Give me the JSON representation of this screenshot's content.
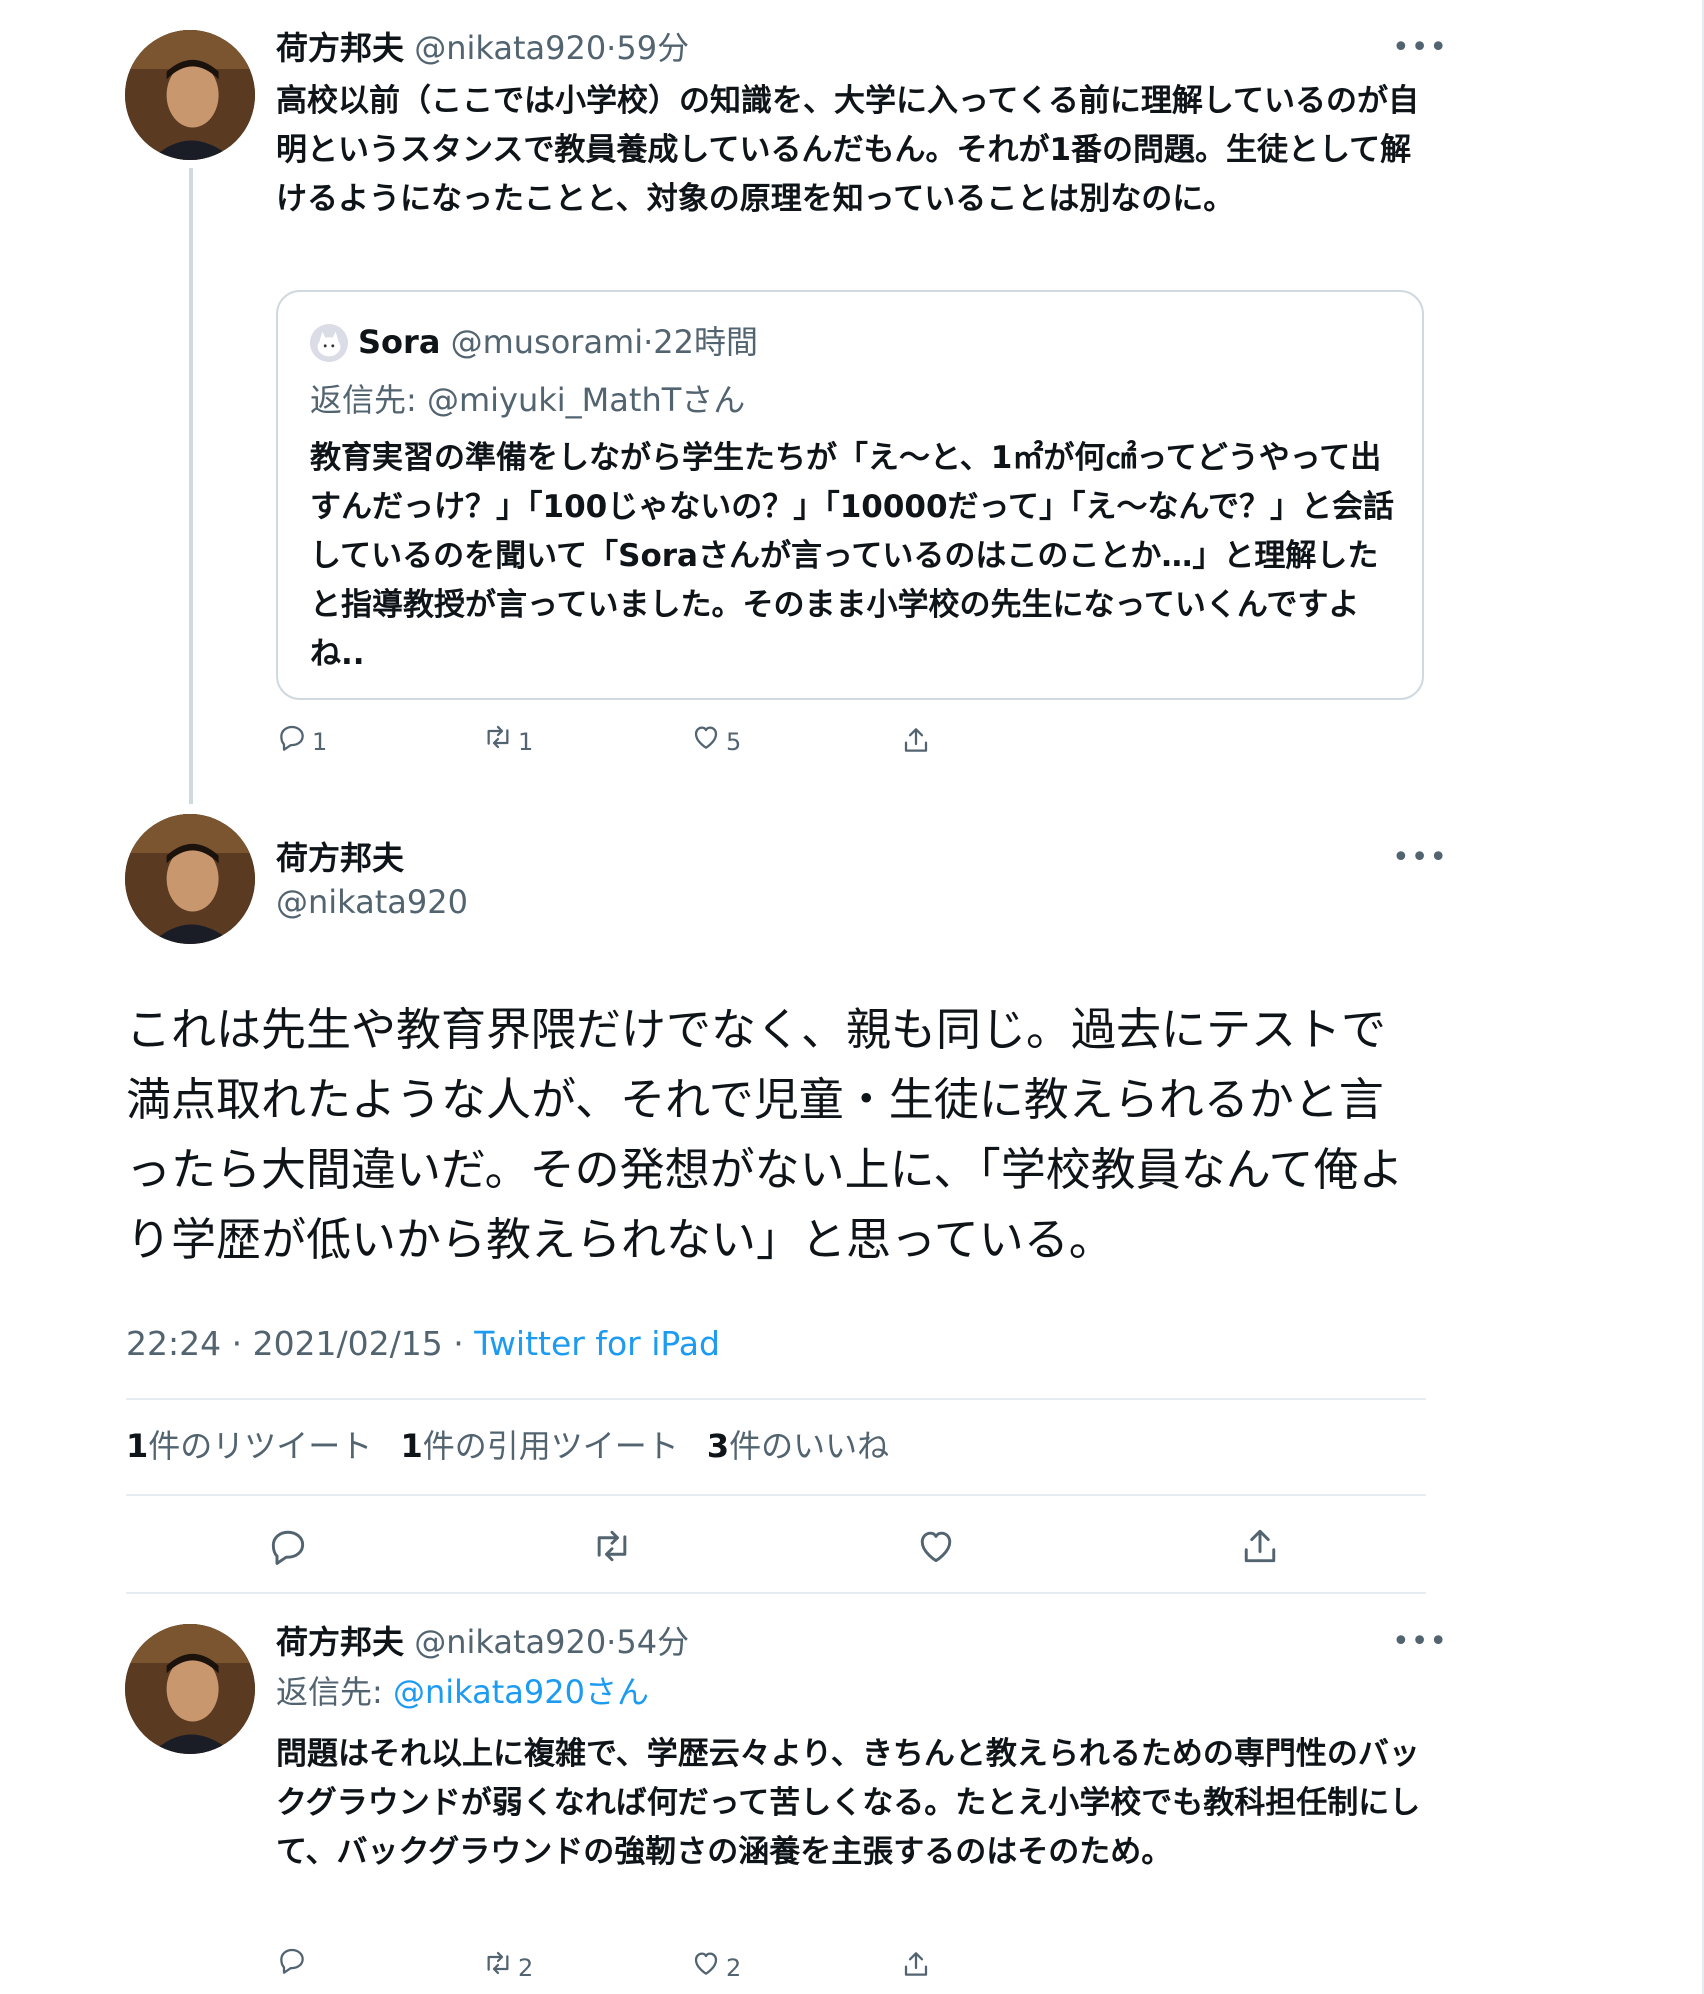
{
  "tweet1": {
    "name": "荷方邦夫",
    "handle": "@nikata920",
    "time": "59分",
    "text": "高校以前（ここでは小学校）の知識を、大学に入ってくる前に理解しているのが自明というスタンスで教員養成しているんだもん。それが1番の問題。生徒として解けるようになったことと、対象の原理を知っていることは別なのに。",
    "more_label": "•••",
    "quote": {
      "name": "Sora",
      "handle": "@musorami",
      "time": "22時間",
      "reply_prefix": "返信先: ",
      "reply_to": "@miyuki_MathTさん",
      "text": "教育実習の準備をしながら学生たちが「え〜と、1㎡が何㎠ってどうやって出すんだっけ？」「100じゃないの？」「10000だって」「え〜なんで？」と会話しているのを聞いて「Soraさんが言っているのはこのことか…」と理解したと指導教授が言っていました。そのまま小学校の先生になっていくんですよね.."
    },
    "actions": {
      "reply_count": "1",
      "retweet_count": "1",
      "like_count": "5"
    }
  },
  "main_tweet": {
    "name": "荷方邦夫",
    "handle": "@nikata920",
    "more_label": "•••",
    "text": "これは先生や教育界隈だけでなく、親も同じ。過去にテストで満点取れたような人が、それで児童・生徒に教えられるかと言ったら大間違いだ。その発想がない上に、「学校教員なんて俺より学歴が低いから教えられない」と思っている。",
    "timestamp": "22:24 · 2021/02/15 · ",
    "source": "Twitter for iPad",
    "stats": {
      "retweets_count": "1",
      "retweets_label": "件のリツイート",
      "quotes_count": "1",
      "quotes_label": "件の引用ツイート",
      "likes_count": "3",
      "likes_label": "件のいいね"
    }
  },
  "tweet3": {
    "name": "荷方邦夫",
    "handle": "@nikata920",
    "time": "54分",
    "more_label": "•••",
    "reply_prefix": "返信先: ",
    "reply_to": "@nikata920さん",
    "text": "問題はそれ以上に複雑で、学歴云々より、きちんと教えられるための専門性のバックグラウンドが弱くなれば何だって苦しくなる。たとえ小学校でも教科担任制にして、バックグラウンドの強靭さの涵養を主張するのはそのため。",
    "actions": {
      "retweet_count": "2",
      "like_count": "2"
    }
  },
  "colors": {
    "text": "#0f1419",
    "secondary": "#536471",
    "link": "#1d9bf0",
    "border": "#cfd9de"
  }
}
